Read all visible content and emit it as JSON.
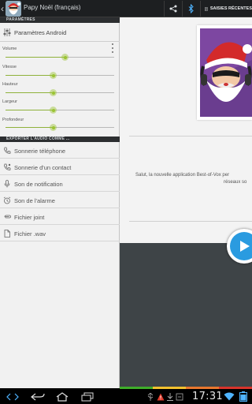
{
  "action_bar": {
    "app_title": "Papy Noël (français)",
    "recent_label": "SAISIES RÉCENTES",
    "icons": [
      "back-chevron-icon",
      "santa-avatar-icon",
      "share-icon",
      "bluetooth-icon",
      "recent-list-icon"
    ]
  },
  "settings": {
    "section_title": "PARAMÈTRES",
    "android_label": "Paramètres Android",
    "sliders": [
      {
        "label": "Volume",
        "value": 0.55
      },
      {
        "label": "Vitesse",
        "value": 0.44
      },
      {
        "label": "Hauteur",
        "value": 0.44
      },
      {
        "label": "Largeur",
        "value": 0.44
      },
      {
        "label": "Profondeur",
        "value": 0.44
      }
    ]
  },
  "export": {
    "section_title": "EXPORTER L'AUDIO COMME ...",
    "items": [
      {
        "label": "Sonnerie téléphone",
        "icon": "phone-icon"
      },
      {
        "label": "Sonnerie d'un contact",
        "icon": "contact-phone-icon"
      },
      {
        "label": "Son de notification",
        "icon": "microphone-icon"
      },
      {
        "label": "Son de l'alarme",
        "icon": "alarm-clock-icon"
      },
      {
        "label": "Fichier joint",
        "icon": "attachment-icon"
      },
      {
        "label": "Fichier .wav",
        "icon": "file-icon"
      }
    ]
  },
  "content": {
    "description_line1": "Salut, la nouvelle application Best-of-Vox per",
    "description_line2": "réseaux so"
  },
  "system_bar": {
    "clock": "17:31"
  },
  "colors": {
    "accent_green": "#9bc433",
    "play_blue": "#2a9be0",
    "strip": [
      "#3fae2a",
      "#f2c12e",
      "#e8772e",
      "#d9342b"
    ]
  }
}
